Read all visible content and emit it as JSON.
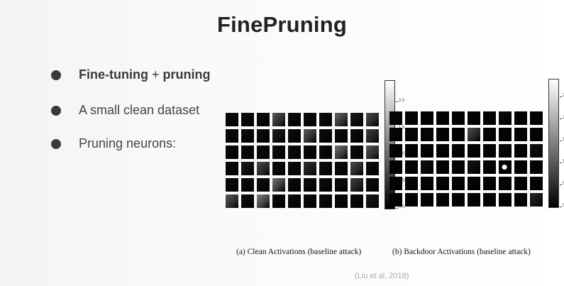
{
  "slide": {
    "title": "FinePruning",
    "bullets": [
      {
        "bold_a": "Fine-tuning",
        "plus": "+",
        "bold_b": "pruning"
      },
      {
        "text": "A small clean dataset"
      },
      {
        "text": "Pruning neurons:"
      }
    ],
    "citation": "(Liu et al, 2018)"
  },
  "figures": [
    {
      "caption": "(a)  Clean Activations (baseline attack)",
      "colorbar_ticks": [
        "0.0",
        "0.5",
        "1.0",
        "1.5",
        "2.0"
      ],
      "colorbar_range": [
        0,
        2.4
      ],
      "rows": 6,
      "cols": 10,
      "activations": [
        [
          0.05,
          0.05,
          0.05,
          0.35,
          0.05,
          0.05,
          0.05,
          0.4,
          0.1,
          0.3
        ],
        [
          0.05,
          0.05,
          0.05,
          0.1,
          0.05,
          0.35,
          0.05,
          0.05,
          0.05,
          0.25
        ],
        [
          0.05,
          0.05,
          0.05,
          0.05,
          0.05,
          0.05,
          0.05,
          0.45,
          0.05,
          0.35
        ],
        [
          0.05,
          0.1,
          0.3,
          0.05,
          0.05,
          0.2,
          0.05,
          0.05,
          0.3,
          0.05
        ],
        [
          0.05,
          0.05,
          0.05,
          0.45,
          0.05,
          0.05,
          0.05,
          0.05,
          0.25,
          0.05
        ],
        [
          0.35,
          0.05,
          0.5,
          0.05,
          0.05,
          0.05,
          0.05,
          0.05,
          0.05,
          0.1
        ]
      ]
    },
    {
      "caption": "(b)  Backdoor Activations (baseline attack)",
      "colorbar_ticks": [
        "0",
        "5",
        "10",
        "15",
        "20",
        "25"
      ],
      "colorbar_range": [
        0,
        29
      ],
      "rows": 6,
      "cols": 10,
      "activations": [
        [
          0.02,
          0.02,
          0.02,
          0.02,
          0.02,
          0.02,
          0.02,
          0.05,
          0.02,
          0.02
        ],
        [
          0.02,
          0.02,
          0.02,
          0.02,
          0.02,
          0.3,
          0.02,
          0.02,
          0.02,
          0.02
        ],
        [
          0.02,
          0.02,
          0.02,
          0.02,
          0.02,
          0.02,
          0.02,
          0.05,
          0.02,
          0.08
        ],
        [
          0.02,
          0.02,
          0.06,
          0.02,
          0.02,
          0.08,
          0.02,
          0.95,
          0.02,
          0.02
        ],
        [
          0.02,
          0.02,
          0.02,
          0.02,
          0.02,
          0.02,
          0.02,
          0.02,
          0.02,
          0.02
        ],
        [
          0.02,
          0.02,
          0.02,
          0.02,
          0.02,
          0.02,
          0.02,
          0.02,
          0.02,
          0.15
        ]
      ]
    }
  ]
}
